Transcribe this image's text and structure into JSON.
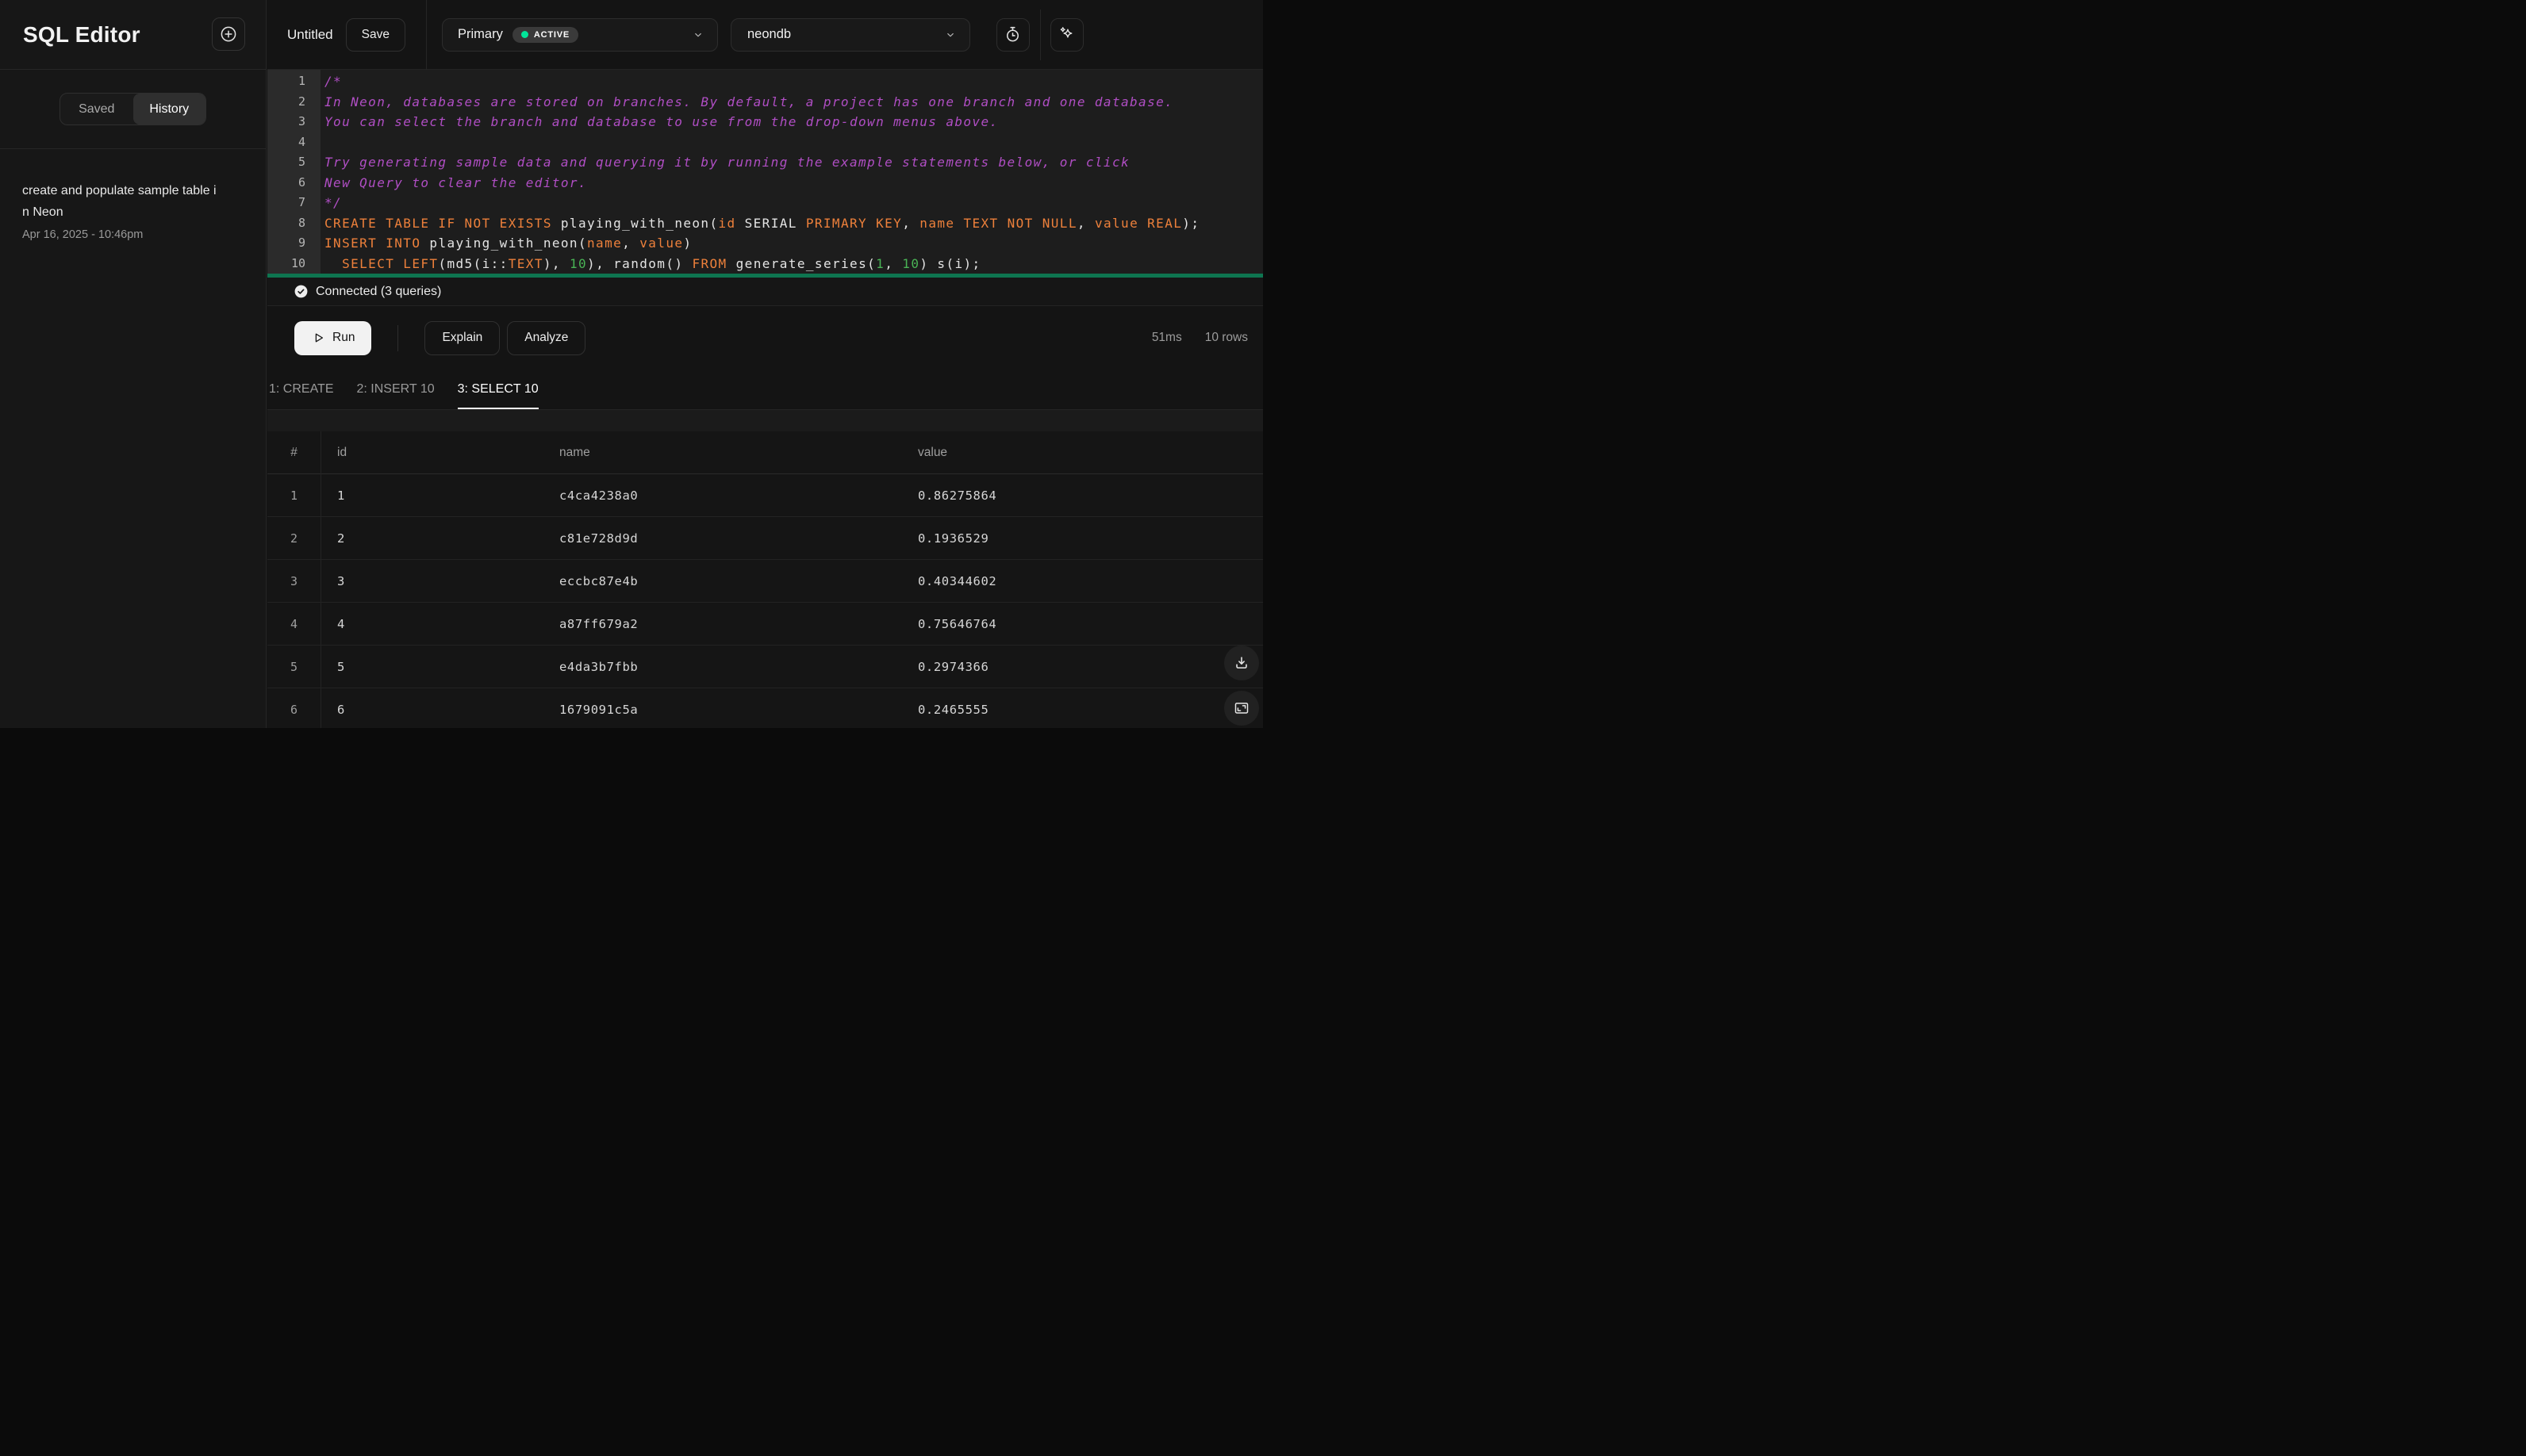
{
  "app": {
    "title": "SQL Editor"
  },
  "sidebar": {
    "tabs": [
      {
        "label": "Saved",
        "active": false
      },
      {
        "label": "History",
        "active": true
      }
    ],
    "history": [
      {
        "title": "create and populate sample table in Neon",
        "date": "Apr 16, 2025 - 10:46pm"
      }
    ]
  },
  "topbar": {
    "query_title": "Untitled",
    "save": "Save",
    "branch": {
      "name": "Primary",
      "status": "ACTIVE"
    },
    "database": {
      "name": "neondb"
    }
  },
  "editor": {
    "lines": [
      {
        "n": "1",
        "s": [
          [
            "c",
            "/*"
          ]
        ]
      },
      {
        "n": "2",
        "s": [
          [
            "c",
            "In Neon, databases are stored on branches. By default, a project has one branch and one database."
          ]
        ]
      },
      {
        "n": "3",
        "s": [
          [
            "c",
            "You can select the branch and database to use from the drop-down menus above."
          ]
        ]
      },
      {
        "n": "4",
        "s": []
      },
      {
        "n": "5",
        "s": [
          [
            "c",
            "Try generating sample data and querying it by running the example statements below, or click"
          ]
        ]
      },
      {
        "n": "6",
        "s": [
          [
            "c",
            "New Query to clear the editor."
          ]
        ]
      },
      {
        "n": "7",
        "s": [
          [
            "c",
            "*/"
          ]
        ]
      },
      {
        "n": "8",
        "s": [
          [
            "k",
            "CREATE TABLE IF NOT EXISTS"
          ],
          [
            "p",
            " playing_with_neon("
          ],
          [
            "k",
            "id"
          ],
          [
            "p",
            " SERIAL "
          ],
          [
            "k",
            "PRIMARY KEY"
          ],
          [
            "p",
            ", "
          ],
          [
            "k",
            "name TEXT NOT NULL"
          ],
          [
            "p",
            ", "
          ],
          [
            "k",
            "value REAL"
          ],
          [
            "p",
            ");"
          ]
        ]
      },
      {
        "n": "9",
        "s": [
          [
            "k",
            "INSERT INTO"
          ],
          [
            "p",
            " playing_with_neon("
          ],
          [
            "k",
            "name"
          ],
          [
            "p",
            ", "
          ],
          [
            "k",
            "value"
          ],
          [
            "p",
            ")"
          ]
        ]
      },
      {
        "n": "10",
        "s": [
          [
            "p",
            "  "
          ],
          [
            "k",
            "SELECT LEFT"
          ],
          [
            "p",
            "(md5(i::"
          ],
          [
            "k",
            "TEXT"
          ],
          [
            "p",
            "), "
          ],
          [
            "num",
            "10"
          ],
          [
            "p",
            "), random() "
          ],
          [
            "k",
            "FROM"
          ],
          [
            "p",
            " generate_series("
          ],
          [
            "num",
            "1"
          ],
          [
            "p",
            ", "
          ],
          [
            "num",
            "10"
          ],
          [
            "p",
            ") s(i);"
          ]
        ]
      }
    ]
  },
  "statusbar": {
    "text": "Connected (3 queries)"
  },
  "toolbar": {
    "run": "Run",
    "explain": "Explain",
    "analyze": "Analyze",
    "duration": "51ms",
    "rowcount": "10 rows"
  },
  "results": {
    "tabs": [
      {
        "label": "1: CREATE",
        "active": false
      },
      {
        "label": "2: INSERT 10",
        "active": false
      },
      {
        "label": "3: SELECT 10",
        "active": true
      }
    ],
    "columns": [
      "#",
      "id",
      "name",
      "value"
    ],
    "rows": [
      [
        "1",
        "1",
        "c4ca4238a0",
        "0.86275864"
      ],
      [
        "2",
        "2",
        "c81e728d9d",
        "0.1936529"
      ],
      [
        "3",
        "3",
        "eccbc87e4b",
        "0.40344602"
      ],
      [
        "4",
        "4",
        "a87ff679a2",
        "0.75646764"
      ],
      [
        "5",
        "5",
        "e4da3b7fbb",
        "0.2974366"
      ],
      [
        "6",
        "6",
        "1679091c5a",
        "0.2465555"
      ]
    ]
  },
  "colors": {
    "accent_green": "#00e599",
    "run_bar_green": "#0e7550",
    "keyword_orange": "#ed803b",
    "comment_purple": "#b04ec4",
    "number_green": "#49b355"
  }
}
